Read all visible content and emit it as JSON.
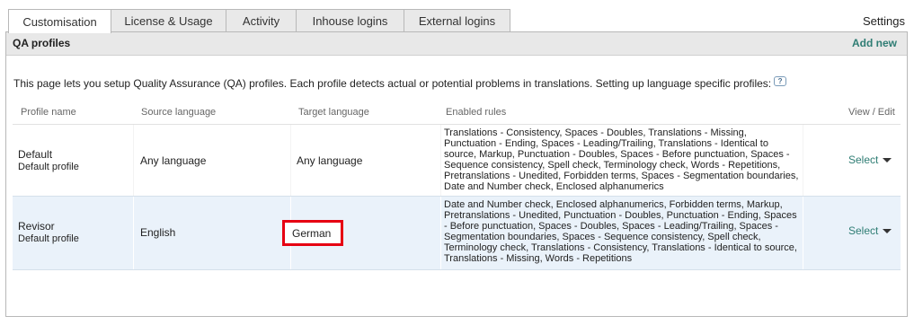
{
  "tabs": [
    {
      "label": "Customisation",
      "active": true
    },
    {
      "label": "License & Usage",
      "active": false
    },
    {
      "label": "Activity",
      "active": false
    },
    {
      "label": "Inhouse logins",
      "active": false
    },
    {
      "label": "External logins",
      "active": false
    }
  ],
  "settings_label": "Settings",
  "panel": {
    "title": "QA profiles",
    "add_new": "Add new",
    "intro": "This page lets you setup Quality Assurance (QA) profiles. Each profile detects actual or potential problems in translations. Setting up language specific profiles:",
    "help_glyph": "?"
  },
  "columns": {
    "profile_name": "Profile name",
    "source_language": "Source language",
    "target_language": "Target language",
    "enabled_rules": "Enabled rules",
    "view_edit": "View / Edit"
  },
  "profiles": [
    {
      "name": "Default",
      "subtitle": "Default profile",
      "source": "Any language",
      "target": "Any language",
      "rules": "Translations - Consistency, Spaces - Doubles, Translations - Missing, Punctuation - Ending, Spaces - Leading/Trailing, Translations - Identical to source, Markup, Punctuation - Doubles, Spaces - Before punctuation, Spaces - Sequence consistency, Spell check, Terminology check, Words - Repetitions, Pretranslations - Unedited, Forbidden terms, Spaces - Segmentation boundaries, Date and Number check, Enclosed alphanumerics",
      "action": "Select"
    },
    {
      "name": "Revisor",
      "subtitle": "Default profile",
      "source": "English",
      "target": "German",
      "rules": "Date and Number check, Enclosed alphanumerics, Forbidden terms, Markup, Pretranslations - Unedited, Punctuation - Doubles, Punctuation - Ending, Spaces - Before punctuation, Spaces - Doubles, Spaces - Leading/Trailing, Spaces - Segmentation boundaries, Spaces - Sequence consistency, Spell check, Terminology check, Translations - Consistency, Translations - Identical to source, Translations - Missing, Words - Repetitions",
      "action": "Select"
    }
  ],
  "colors": {
    "link": "#2f7d74",
    "highlight_border": "#e60012",
    "selected_row": "#eaf2fa"
  }
}
